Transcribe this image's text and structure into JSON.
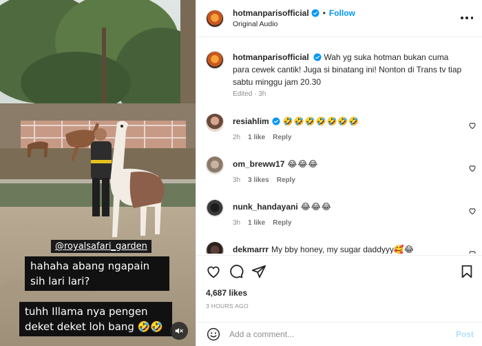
{
  "post": {
    "username": "hotmanparisofficial",
    "follow_label": "Follow",
    "separator": "•",
    "audio": "Original Audio",
    "caption_text": "Wah yg suka hotman bukan cuma para cewek cantik! Juga si binatang ini! Nonton di Trans tv tiap sabtu minggu jam 20.30",
    "caption_meta": "Edited · 3h",
    "accent_color": "#0095f6"
  },
  "video": {
    "tag": "@royalsafari_garden",
    "caption_1": "hahaha abang ngapain sih lari lari?",
    "caption_2": "tuhh Illama nya pengen deket deket loh bang 🤣🤣",
    "mute_icon": "speaker-muted-icon"
  },
  "comments": [
    {
      "username": "resiahlim",
      "verified": true,
      "text": "🤣🤣🤣🤣🤣🤣🤣",
      "time": "2h",
      "likes": "1 like",
      "reply": "Reply"
    },
    {
      "username": "om_breww17",
      "verified": false,
      "text": "😂😂😂",
      "time": "3h",
      "likes": "3 likes",
      "reply": "Reply"
    },
    {
      "username": "nunk_handayani",
      "verified": false,
      "text": "😂😂😂",
      "time": "3h",
      "likes": "1 like",
      "reply": "Reply"
    },
    {
      "username": "dekmarrr",
      "verified": false,
      "text": "My bby honey, my sugar daddyyy🥰😂",
      "time": "",
      "likes": "",
      "reply": ""
    }
  ],
  "actions": {
    "icons": [
      "heart-icon",
      "comment-icon",
      "share-icon",
      "bookmark-icon"
    ],
    "likes_count": "4,687 likes",
    "time_ago": "3 HOURS AGO"
  },
  "add_comment": {
    "placeholder": "Add a comment...",
    "post_label": "Post"
  }
}
